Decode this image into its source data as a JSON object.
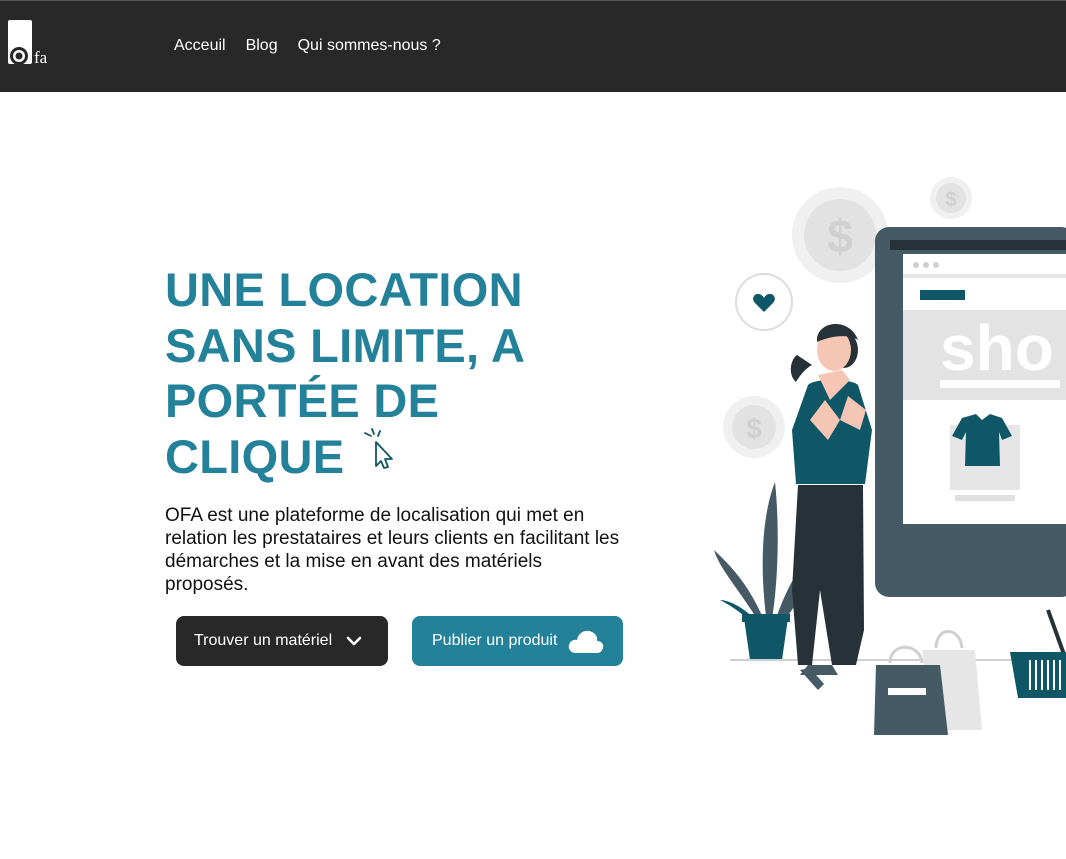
{
  "header": {
    "logo_text": "fa",
    "nav": [
      {
        "label": "Acceuil"
      },
      {
        "label": "Blog"
      },
      {
        "label": "Qui sommes-nous ?"
      }
    ]
  },
  "hero": {
    "title": "UNE LOCATION SANS LIMITE, A PORTÉE DE CLIQUE",
    "description": "OFA est une plateforme de localisation qui met en relation les prestataires et leurs clients en facilitant les démarches et la mise en avant des matériels proposés.",
    "buttons": {
      "find_label": "Trouver un matériel",
      "publish_label": "Publier un produit"
    },
    "illustration": {
      "screen_text": "sho"
    }
  },
  "colors": {
    "navbar": "#282828",
    "accent": "#23819a",
    "dark_teal": "#0f5767"
  },
  "icons": [
    "logo-icon",
    "cursor-click-icon",
    "chevron-down-icon",
    "cloud-icon",
    "heart-icon",
    "dollar-icon"
  ]
}
